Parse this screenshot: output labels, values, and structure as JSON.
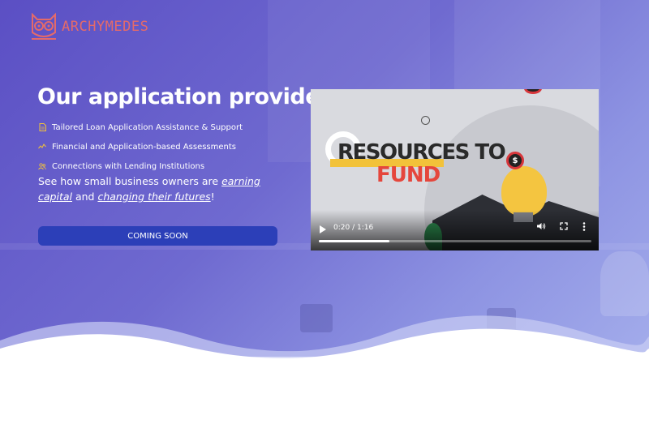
{
  "brand": {
    "name": "ARCHYMEDES",
    "logo_icon": "owl-icon",
    "color": "#e46a6a"
  },
  "hero": {
    "headline": "Our application provides:",
    "features": [
      {
        "icon": "document-icon",
        "label": "Tailored Loan Application Assistance & Support"
      },
      {
        "icon": "chart-line-icon",
        "label": "Financial and Application-based Assessments"
      },
      {
        "icon": "people-icon",
        "label": "Connections with Lending Institutions"
      }
    ],
    "blurb": {
      "text1": "See how small business owners are ",
      "link1": "earning capital",
      "text2": " and ",
      "link2": "changing their futures",
      "text3": "!"
    },
    "cta_label": "COMING SOON"
  },
  "video": {
    "title_line1_a": "RESOURCES",
    "title_line1_b": " TO",
    "title_line2": "FUND",
    "coin_symbol": "$",
    "time": "0:20 / 1:16",
    "progress": 0.26,
    "controls": [
      "play-icon",
      "volume-icon",
      "fullscreen-icon",
      "more-options-icon"
    ]
  },
  "colors": {
    "accent": "#2c3fb8",
    "video_title_red": "#e5463c",
    "video_yellow": "#f2c23a"
  }
}
